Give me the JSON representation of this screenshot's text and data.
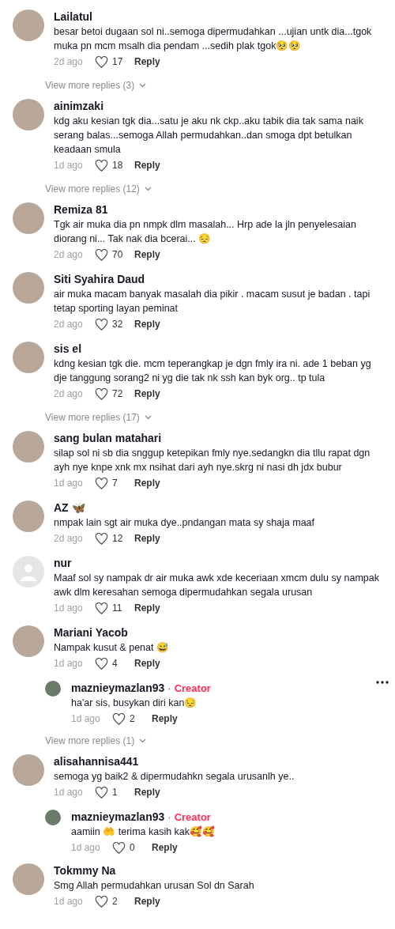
{
  "items": [
    {
      "kind": "comment",
      "default_avatar": false,
      "author": "Lailatul",
      "text": "besar betoi dugaan sol ni..semoga dipermudahkan ...ujian untk dia...tgok muka pn mcm msalh dia pendam ...sedih plak tgok🥺🥺",
      "time": "2d ago",
      "likes": "17",
      "reply": "Reply"
    },
    {
      "kind": "more",
      "text": "View more replies (3)"
    },
    {
      "kind": "comment",
      "default_avatar": false,
      "author": "ainimzaki",
      "text": "kdg aku kesian tgk dia...satu je aku nk ckp..aku tabik dia tak sama naik serang balas...semoga Allah permudahkan..dan smoga dpt betulkan keadaan smula",
      "time": "1d ago",
      "likes": "18",
      "reply": "Reply"
    },
    {
      "kind": "more",
      "text": "View more replies (12)"
    },
    {
      "kind": "comment",
      "default_avatar": false,
      "author": "Remiza 81",
      "text": "Tgk air muka dia pn nmpk dlm masalah... Hrp ade la jln penyelesaian diorang ni... Tak nak dia bcerai... 😔",
      "time": "2d ago",
      "likes": "70",
      "reply": "Reply"
    },
    {
      "kind": "comment",
      "default_avatar": false,
      "author": "Siti Syahira Daud",
      "text": "air muka macam banyak masalah dia pikir . macam susut je badan . tapi tetap sporting layan peminat",
      "time": "2d ago",
      "likes": "32",
      "reply": "Reply"
    },
    {
      "kind": "comment",
      "default_avatar": false,
      "author": "sis el",
      "text": "kdng kesian tgk die. mcm teperangkap je dgn fmly ira ni. ade 1 beban yg dje tanggung sorang2 ni yg die tak nk ssh kan byk org.. tp tula",
      "time": "2d ago",
      "likes": "72",
      "reply": "Reply"
    },
    {
      "kind": "more",
      "text": "View more replies (17)"
    },
    {
      "kind": "comment",
      "default_avatar": false,
      "author": "sang bulan matahari",
      "text": "silap sol ni sb dia snggup ketepikan fmly nye.sedangkn dia tllu rapat dgn ayh nye knpe xnk mx nsihat dari ayh nye.skrg ni nasi dh jdx bubur",
      "time": "1d ago",
      "likes": "7",
      "reply": "Reply"
    },
    {
      "kind": "comment",
      "default_avatar": false,
      "author": "AZ 🦋",
      "text": "nmpak lain sgt air muka dye..pndangan mata sy shaja maaf",
      "time": "2d ago",
      "likes": "12",
      "reply": "Reply"
    },
    {
      "kind": "comment",
      "default_avatar": true,
      "author": "nur",
      "text": "Maaf sol sy nampak dr air muka awk xde keceriaan xmcm dulu sy nampak awk dlm keresahan semoga dipermudahkan segala urusan",
      "time": "1d ago",
      "likes": "11",
      "reply": "Reply"
    },
    {
      "kind": "comment",
      "default_avatar": false,
      "author": "Mariani Yacob",
      "text": "Nampak kusut & penat 😅",
      "time": "1d ago",
      "likes": "4",
      "reply": "Reply"
    },
    {
      "kind": "reply",
      "default_avatar": false,
      "author": "maznieymazlan93",
      "separator": "·",
      "badge": "Creator",
      "menu": true,
      "text": "ha'ar sis, busykan diri kan😔",
      "time": "1d ago",
      "likes": "2",
      "reply": "Reply"
    },
    {
      "kind": "more",
      "text": "View more replies (1)"
    },
    {
      "kind": "comment",
      "default_avatar": false,
      "author": "alisahannisa441",
      "text": "semoga yg baik2 & dipermudahkn segala urusanlh ye..",
      "time": "1d ago",
      "likes": "1",
      "reply": "Reply"
    },
    {
      "kind": "reply",
      "default_avatar": false,
      "author": "maznieymazlan93",
      "separator": "·",
      "badge": "Creator",
      "menu": false,
      "text": "aamiin 🤲 terima kasih kak🥰🥰",
      "time": "1d ago",
      "likes": "0",
      "reply": "Reply"
    },
    {
      "kind": "comment",
      "default_avatar": false,
      "author": "Tokmmy Na",
      "text": "Smg Allah permudahkan urusan Sol dn Sarah",
      "time": "1d ago",
      "likes": "2",
      "reply": "Reply"
    }
  ]
}
